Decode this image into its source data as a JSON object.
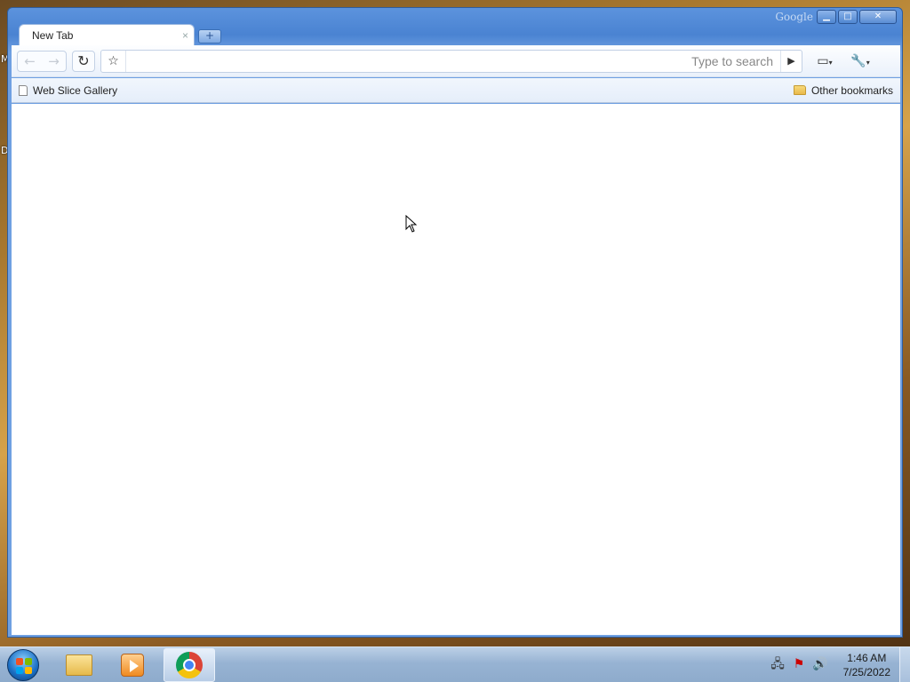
{
  "desktop": {
    "letters": [
      "M",
      "D"
    ]
  },
  "window": {
    "brand": "Google",
    "controls": {
      "minimize": "▁",
      "maximize": "□",
      "close": "✕"
    }
  },
  "tabs": [
    {
      "title": "New Tab",
      "close_glyph": "×"
    }
  ],
  "new_tab_glyph": "+",
  "toolbar": {
    "back_glyph": "←",
    "forward_glyph": "→",
    "reload_glyph": "↻",
    "star_glyph": "☆",
    "omnibox": {
      "value": "",
      "placeholder": "Type to search"
    },
    "go_glyph": "▶",
    "page_menu_glyph": "▭",
    "wrench_glyph": "🔧",
    "caret_glyph": "▾"
  },
  "bookmarks": {
    "items": [
      {
        "label": "Web Slice Gallery",
        "icon": "page-icon"
      }
    ],
    "other": {
      "label": "Other bookmarks",
      "icon": "folder-icon"
    }
  },
  "taskbar": {
    "apps": [
      {
        "name": "Windows Explorer",
        "icon": "explorer-icon",
        "active": false
      },
      {
        "name": "Windows Media Player",
        "icon": "media-icon",
        "active": false
      },
      {
        "name": "Google Chrome",
        "icon": "chrome-icon",
        "active": true
      }
    ],
    "tray": {
      "network": "🖧",
      "flag": "⚑",
      "volume": "🔊"
    },
    "clock": {
      "time": "1:46 AM",
      "date": "7/25/2022"
    }
  }
}
